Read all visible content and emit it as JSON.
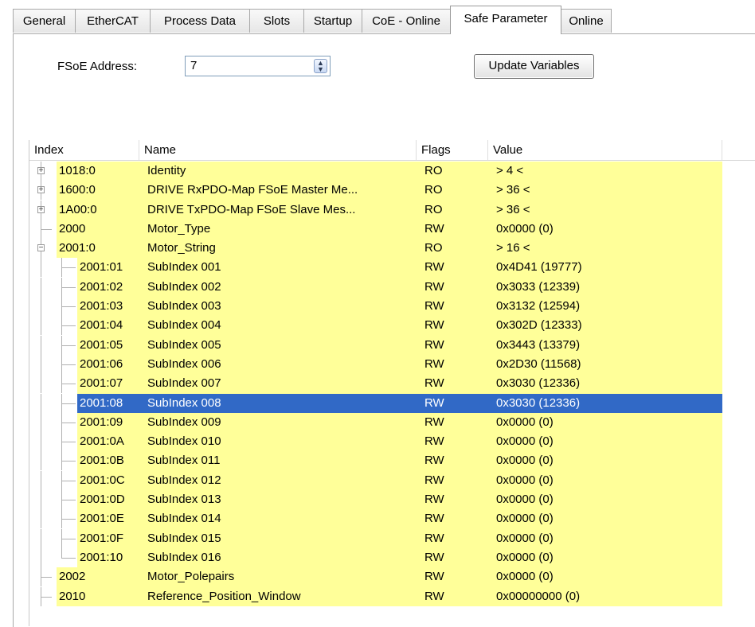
{
  "tabs": [
    {
      "label": "General",
      "active": false
    },
    {
      "label": "EtherCAT",
      "active": false
    },
    {
      "label": "Process Data",
      "active": false
    },
    {
      "label": "Slots",
      "active": false
    },
    {
      "label": "Startup",
      "active": false
    },
    {
      "label": "CoE - Online",
      "active": false
    },
    {
      "label": "Safe Parameter",
      "active": true
    },
    {
      "label": "Online",
      "active": false
    }
  ],
  "fsoe": {
    "label": "FSoE Address:",
    "value": "7"
  },
  "update_button": "Update Variables",
  "columns": [
    "Index",
    "Name",
    "Flags",
    "Value"
  ],
  "rows": [
    {
      "index": "1018:0",
      "name": "Identity",
      "flags": "RO",
      "value": "> 4 <",
      "level": 0,
      "expander": "+"
    },
    {
      "index": "1600:0",
      "name": "DRIVE RxPDO-Map FSoE Master Me...",
      "flags": "RO",
      "value": "> 36 <",
      "level": 0,
      "expander": "+"
    },
    {
      "index": "1A00:0",
      "name": "DRIVE TxPDO-Map FSoE Slave Mes...",
      "flags": "RO",
      "value": "> 36 <",
      "level": 0,
      "expander": "+"
    },
    {
      "index": "2000",
      "name": "Motor_Type",
      "flags": "RW",
      "value": "0x0000 (0)",
      "level": 0,
      "expander": ""
    },
    {
      "index": "2001:0",
      "name": "Motor_String",
      "flags": "RO",
      "value": "> 16 <",
      "level": 0,
      "expander": "−"
    },
    {
      "index": "2001:01",
      "name": "SubIndex 001",
      "flags": "RW",
      "value": "0x4D41 (19777)",
      "level": 1,
      "expander": ""
    },
    {
      "index": "2001:02",
      "name": "SubIndex 002",
      "flags": "RW",
      "value": "0x3033 (12339)",
      "level": 1,
      "expander": ""
    },
    {
      "index": "2001:03",
      "name": "SubIndex 003",
      "flags": "RW",
      "value": "0x3132 (12594)",
      "level": 1,
      "expander": ""
    },
    {
      "index": "2001:04",
      "name": "SubIndex 004",
      "flags": "RW",
      "value": "0x302D (12333)",
      "level": 1,
      "expander": ""
    },
    {
      "index": "2001:05",
      "name": "SubIndex 005",
      "flags": "RW",
      "value": "0x3443 (13379)",
      "level": 1,
      "expander": ""
    },
    {
      "index": "2001:06",
      "name": "SubIndex 006",
      "flags": "RW",
      "value": "0x2D30 (11568)",
      "level": 1,
      "expander": ""
    },
    {
      "index": "2001:07",
      "name": "SubIndex 007",
      "flags": "RW",
      "value": "0x3030 (12336)",
      "level": 1,
      "expander": ""
    },
    {
      "index": "2001:08",
      "name": "SubIndex 008",
      "flags": "RW",
      "value": "0x3030 (12336)",
      "level": 1,
      "expander": "",
      "selected": true
    },
    {
      "index": "2001:09",
      "name": "SubIndex 009",
      "flags": "RW",
      "value": "0x0000 (0)",
      "level": 1,
      "expander": ""
    },
    {
      "index": "2001:0A",
      "name": "SubIndex 010",
      "flags": "RW",
      "value": "0x0000 (0)",
      "level": 1,
      "expander": ""
    },
    {
      "index": "2001:0B",
      "name": "SubIndex 011",
      "flags": "RW",
      "value": "0x0000 (0)",
      "level": 1,
      "expander": ""
    },
    {
      "index": "2001:0C",
      "name": "SubIndex 012",
      "flags": "RW",
      "value": "0x0000 (0)",
      "level": 1,
      "expander": ""
    },
    {
      "index": "2001:0D",
      "name": "SubIndex 013",
      "flags": "RW",
      "value": "0x0000 (0)",
      "level": 1,
      "expander": ""
    },
    {
      "index": "2001:0E",
      "name": "SubIndex 014",
      "flags": "RW",
      "value": "0x0000 (0)",
      "level": 1,
      "expander": ""
    },
    {
      "index": "2001:0F",
      "name": "SubIndex 015",
      "flags": "RW",
      "value": "0x0000 (0)",
      "level": 1,
      "expander": ""
    },
    {
      "index": "2001:10",
      "name": "SubIndex 016",
      "flags": "RW",
      "value": "0x0000 (0)",
      "level": 1,
      "expander": ""
    },
    {
      "index": "2002",
      "name": "Motor_Polepairs",
      "flags": "RW",
      "value": "0x0000 (0)",
      "level": 0,
      "expander": ""
    },
    {
      "index": "2010",
      "name": "Reference_Position_Window",
      "flags": "RW",
      "value": "0x00000000 (0)",
      "level": 0,
      "expander": ""
    }
  ]
}
